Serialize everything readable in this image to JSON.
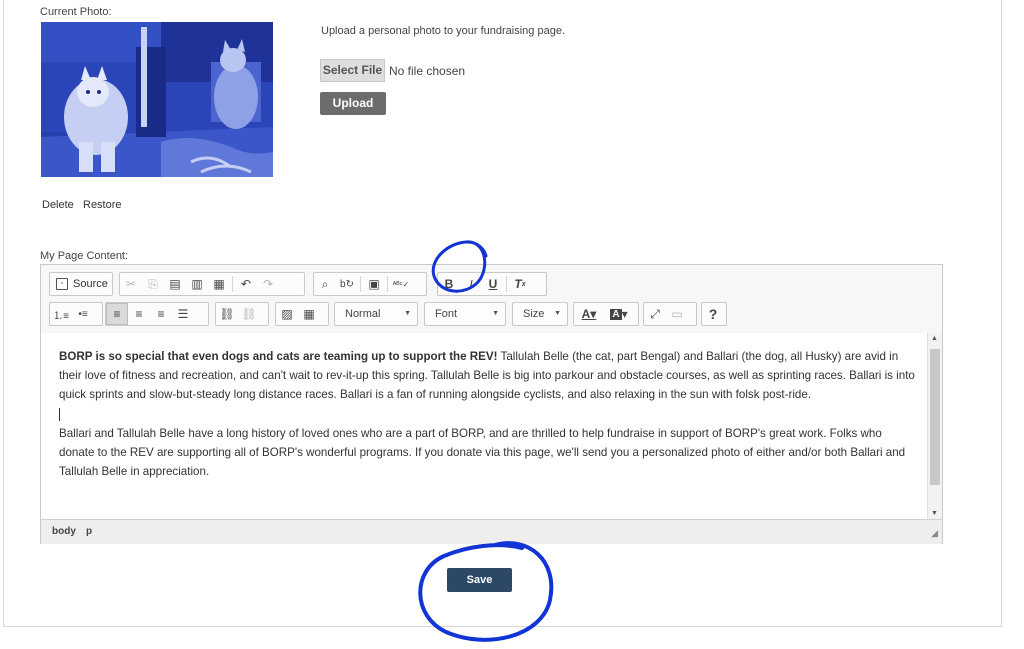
{
  "photo_section": {
    "current_photo_label": "Current Photo:",
    "upload_hint": "Upload a personal photo to your fundraising page.",
    "select_file_label": "Select File",
    "no_file_text": "No file chosen",
    "upload_label": "Upload",
    "delete_label": "Delete",
    "restore_label": "Restore"
  },
  "content_section": {
    "label": "My Page Content:"
  },
  "editor": {
    "toolbar": {
      "source_label": "Source",
      "format_value": "Normal",
      "font_value": "Font",
      "size_value": "Size",
      "bold_glyph": "B",
      "italic_glyph": "I",
      "underline_glyph": "U",
      "help_glyph": "?"
    },
    "content": {
      "paragraph1_bold": "BORP is so special that even dogs and cats are teaming up to support the REV!",
      "paragraph1_rest": " Tallulah Belle (the cat, part Bengal) and Ballari (the dog, all Husky) are avid in their love of fitness and recreation, and can't wait to rev-it-up this spring. Tallulah Belle is big into parkour and obstacle courses, as well as sprinting races. Ballari is into quick sprints and slow-but-steady long distance races. Ballari is a fan of running alongside cyclists, and also relaxing in the sun with folsk post-ride.",
      "paragraph2": "Ballari and Tallulah Belle have a long history of loved ones who are a part of BORP, and are thrilled to help fundraise in support of BORP's great work. Folks who donate to the REV are supporting all of BORP's wonderful programs. If you donate via this page, we'll send you a personalized photo of either and/or both Ballari and Tallulah Belle in appreciation."
    },
    "status_path": [
      "body",
      "p"
    ]
  },
  "save_label": "Save",
  "colors": {
    "annotation": "#1234d4",
    "save_button": "#2d4766",
    "photo_tint": "#2a45b8"
  }
}
